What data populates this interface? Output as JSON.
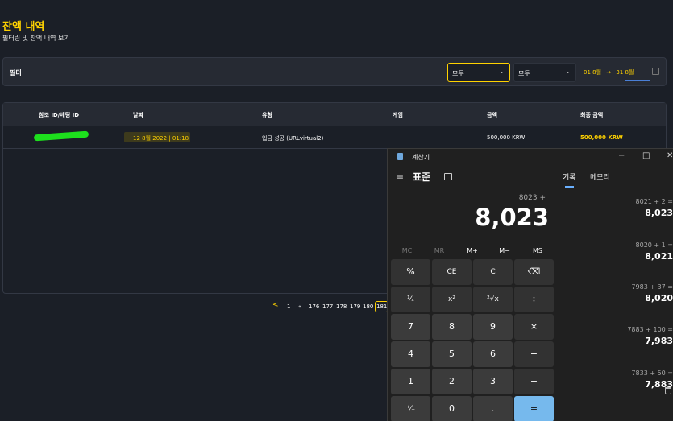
{
  "page": {
    "title": "잔액 내역",
    "subtitle": "필터링 및 잔액 내역 보기"
  },
  "filter": {
    "label": "필터",
    "select1": "모두",
    "select2": "모두",
    "date_from": "01 8월",
    "date_arrow": "→",
    "date_to": "31 8월"
  },
  "table": {
    "headers": [
      "참조 ID/베팅 ID",
      "날짜",
      "유형",
      "게임",
      "금액",
      "최종 금액"
    ],
    "rows": [
      {
        "ref": "",
        "date": "12 8월 2022 | 01:18",
        "type": "입금 성공 (URLvirtual2)",
        "game": "",
        "amount": "500,000 KRW",
        "final": "500,000 KRW"
      }
    ]
  },
  "pager": {
    "prev": "<",
    "first": "1",
    "jump": "«",
    "pages": [
      "176",
      "177",
      "178",
      "179",
      "180",
      "181"
    ]
  },
  "calculator": {
    "title": "계산기",
    "mode": "표준",
    "tab_history": "기록",
    "tab_memory": "메모리",
    "expression": "8023 +",
    "display": "8,023",
    "memory_buttons": [
      "MC",
      "MR",
      "M+",
      "M−",
      "MS"
    ],
    "keys": [
      [
        "%",
        "CE",
        "C",
        "⌫"
      ],
      [
        "¹⁄ₓ",
        "x²",
        "²√x",
        "÷"
      ],
      [
        "7",
        "8",
        "9",
        "×"
      ],
      [
        "4",
        "5",
        "6",
        "−"
      ],
      [
        "1",
        "2",
        "3",
        "+"
      ],
      [
        "⁺⁄₋",
        "0",
        ".",
        "="
      ]
    ],
    "history": [
      {
        "expr": "8021   +   2 =",
        "result": "8,023"
      },
      {
        "expr": "8020   +   1 =",
        "result": "8,021"
      },
      {
        "expr": "7983   +   37 =",
        "result": "8,020"
      },
      {
        "expr": "7883   +   100 =",
        "result": "7,983"
      },
      {
        "expr": "7833   +   50 =",
        "result": "7,883"
      }
    ],
    "window_buttons": [
      "−",
      "□",
      "✕"
    ]
  }
}
